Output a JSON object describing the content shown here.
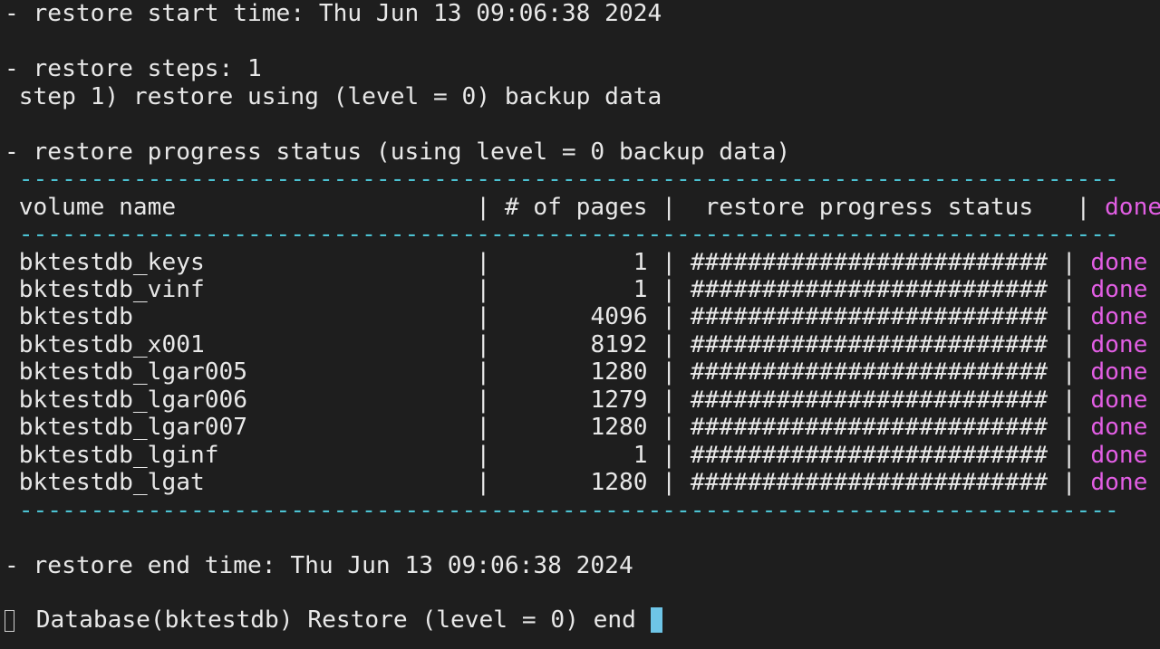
{
  "terminal": {
    "start_time": "- restore start time: Thu Jun 13 09:06:38 2024",
    "steps_header": "- restore steps: 1",
    "step_1": " step 1) restore using (level = 0) backup data",
    "progress_header": "- restore progress status (using level = 0 backup data)",
    "separator": " -----------------------------------------------------------------------------",
    "table": {
      "header": {
        "volume": " volume name                     |",
        "pages": " # of pages |",
        "status": "  restore progress status   |",
        "done": " done"
      },
      "rows": [
        {
          "volume": "bktestdb_keys",
          "pages": "1",
          "progress": "#########################",
          "done": "done"
        },
        {
          "volume": "bktestdb_vinf",
          "pages": "1",
          "progress": "#########################",
          "done": "done"
        },
        {
          "volume": "bktestdb",
          "pages": "4096",
          "progress": "#########################",
          "done": "done"
        },
        {
          "volume": "bktestdb_x001",
          "pages": "8192",
          "progress": "#########################",
          "done": "done"
        },
        {
          "volume": "bktestdb_lgar005",
          "pages": "1280",
          "progress": "#########################",
          "done": "done"
        },
        {
          "volume": "bktestdb_lgar006",
          "pages": "1279",
          "progress": "#########################",
          "done": "done"
        },
        {
          "volume": "bktestdb_lgar007",
          "pages": "1280",
          "progress": "#########################",
          "done": "done"
        },
        {
          "volume": "bktestdb_lginf",
          "pages": "1",
          "progress": "#########################",
          "done": "done"
        },
        {
          "volume": "bktestdb_lgat",
          "pages": "1280",
          "progress": "#########################",
          "done": "done"
        }
      ]
    },
    "end_time": "- restore end time: Thu Jun 13 09:06:38 2024",
    "final_message": " Database(bktestdb) Restore (level = 0) end "
  }
}
